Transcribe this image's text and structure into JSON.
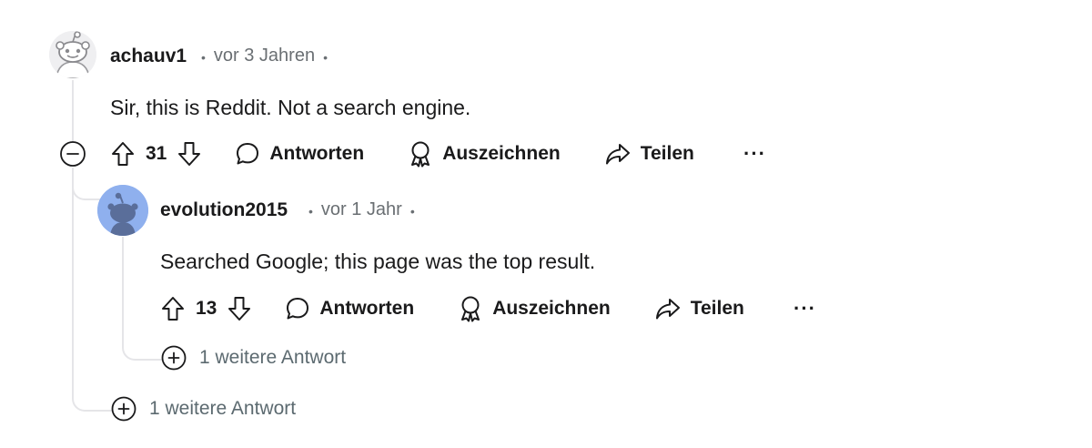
{
  "comments": [
    {
      "username": "achauv1",
      "time": "vor 3 Jahren",
      "body": "Sir, this is Reddit. Not a search engine.",
      "votes": "31",
      "reply_label": "Antworten",
      "award_label": "Auszeichnen",
      "share_label": "Teilen",
      "more_label": "···",
      "more_replies": "1 weitere Antwort"
    },
    {
      "username": "evolution2015",
      "time": "vor 1 Jahr",
      "body": "Searched Google; this page was the top result.",
      "votes": "13",
      "reply_label": "Antworten",
      "award_label": "Auszeichnen",
      "share_label": "Teilen",
      "more_label": "···",
      "more_replies": "1 weitere Antwort"
    }
  ],
  "meta_separator": "•",
  "colors": {
    "text": "#1a1a1b",
    "meta": "#6a6f73",
    "thread_line": "#e5e5e8",
    "avatar_blue_bg": "#8fb0ee",
    "avatar_blue_fg": "#5a6e9a"
  },
  "icons": {
    "upvote": "arrow-up-icon",
    "downvote": "arrow-down-icon",
    "reply": "chat-bubble-icon",
    "award": "award-ribbon-icon",
    "share": "share-arrow-icon",
    "collapse": "minus-circle-icon",
    "expand": "plus-circle-icon"
  }
}
